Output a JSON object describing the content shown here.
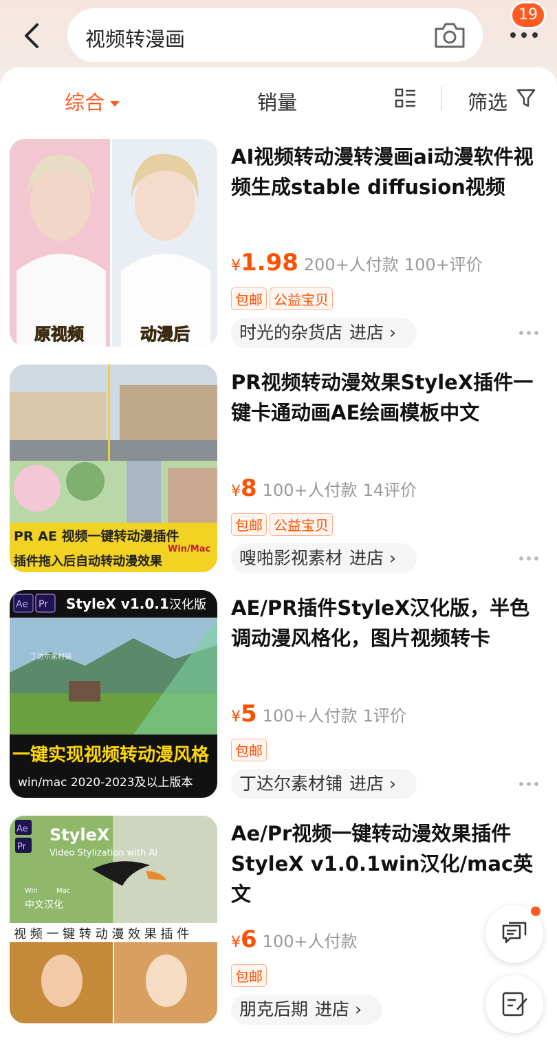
{
  "header": {
    "search_query": "视频转漫画",
    "badge_count": "19"
  },
  "sort_bar": {
    "comprehensive": "综合",
    "sales": "销量",
    "filter": "筛选"
  },
  "products": [
    {
      "title": "AI视频转动漫转漫画ai动漫软件视频生成stable diffusion视频",
      "yen": "¥",
      "price": "1.98",
      "sold": "200+人付款",
      "reviews": "100+评价",
      "tags": [
        "包邮",
        "公益宝贝"
      ],
      "shop": "时光的杂货店",
      "enter": "进店",
      "image_text": [
        "原视频",
        "动漫后"
      ]
    },
    {
      "title": "PR视频转动漫效果StyleX插件一键卡通动画AE绘画模板中文",
      "yen": "¥",
      "price": "8",
      "sold": "100+人付款",
      "reviews": "14评价",
      "tags": [
        "包邮",
        "公益宝贝"
      ],
      "shop": "嗖啪影视素材",
      "enter": "进店",
      "image_text": [
        "PR AE 视频一键转动漫插件",
        "Win/Mac",
        "插件拖入后自动转动漫效果"
      ]
    },
    {
      "title": "AE/PR插件StyleX汉化版，半色调动漫风格化，图片视频转卡",
      "yen": "¥",
      "price": "5",
      "sold": "100+人付款",
      "reviews": "1评价",
      "tags": [
        "包邮"
      ],
      "shop": "丁达尔素材铺",
      "enter": "进店",
      "image_text": [
        "Ae",
        "Pr",
        "StyleX v1.0.1",
        "汉化版",
        "丁达尔素材铺",
        "一键实现视频转动漫风格",
        "win/mac 2020-2023及以上版本"
      ]
    },
    {
      "title": "Ae/Pr视频一键转动漫效果插件StyleX v1.0.1win汉化/mac英文",
      "yen": "¥",
      "price": "6",
      "sold": "100+人付款",
      "reviews": "",
      "tags": [
        "包邮"
      ],
      "shop": "朋克后期",
      "enter": "进店",
      "image_text": [
        "Ae",
        "Pr",
        "StyleX",
        "Video Stylization with AI",
        "Win",
        "Mac",
        "中文汉化",
        "视 频 一 键 转 动 漫 效 果 插 件"
      ]
    }
  ],
  "colors": {
    "accent": "#ff5000",
    "badge": "#ff5a1f"
  }
}
